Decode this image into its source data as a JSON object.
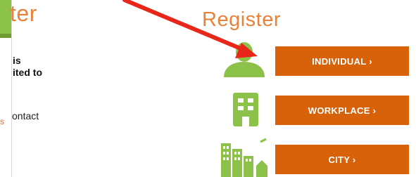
{
  "left_panel": {
    "title_fragment": "ter",
    "bold_line_1": "is",
    "bold_line_2": "ited to",
    "contact_fragment": "ontact",
    "link_fragment": "s"
  },
  "register": {
    "title": "Register",
    "buttons": [
      {
        "label": "INDIVIDUAL ›",
        "icon": "person-icon"
      },
      {
        "label": "WORKPLACE ›",
        "icon": "building-icon"
      },
      {
        "label": "CITY ›",
        "icon": "city-icon"
      }
    ]
  },
  "colors": {
    "accent_orange": "#d7620a",
    "title_orange": "#e8823a",
    "icon_green": "#8cc14a",
    "annotation_red": "#e8261a"
  }
}
